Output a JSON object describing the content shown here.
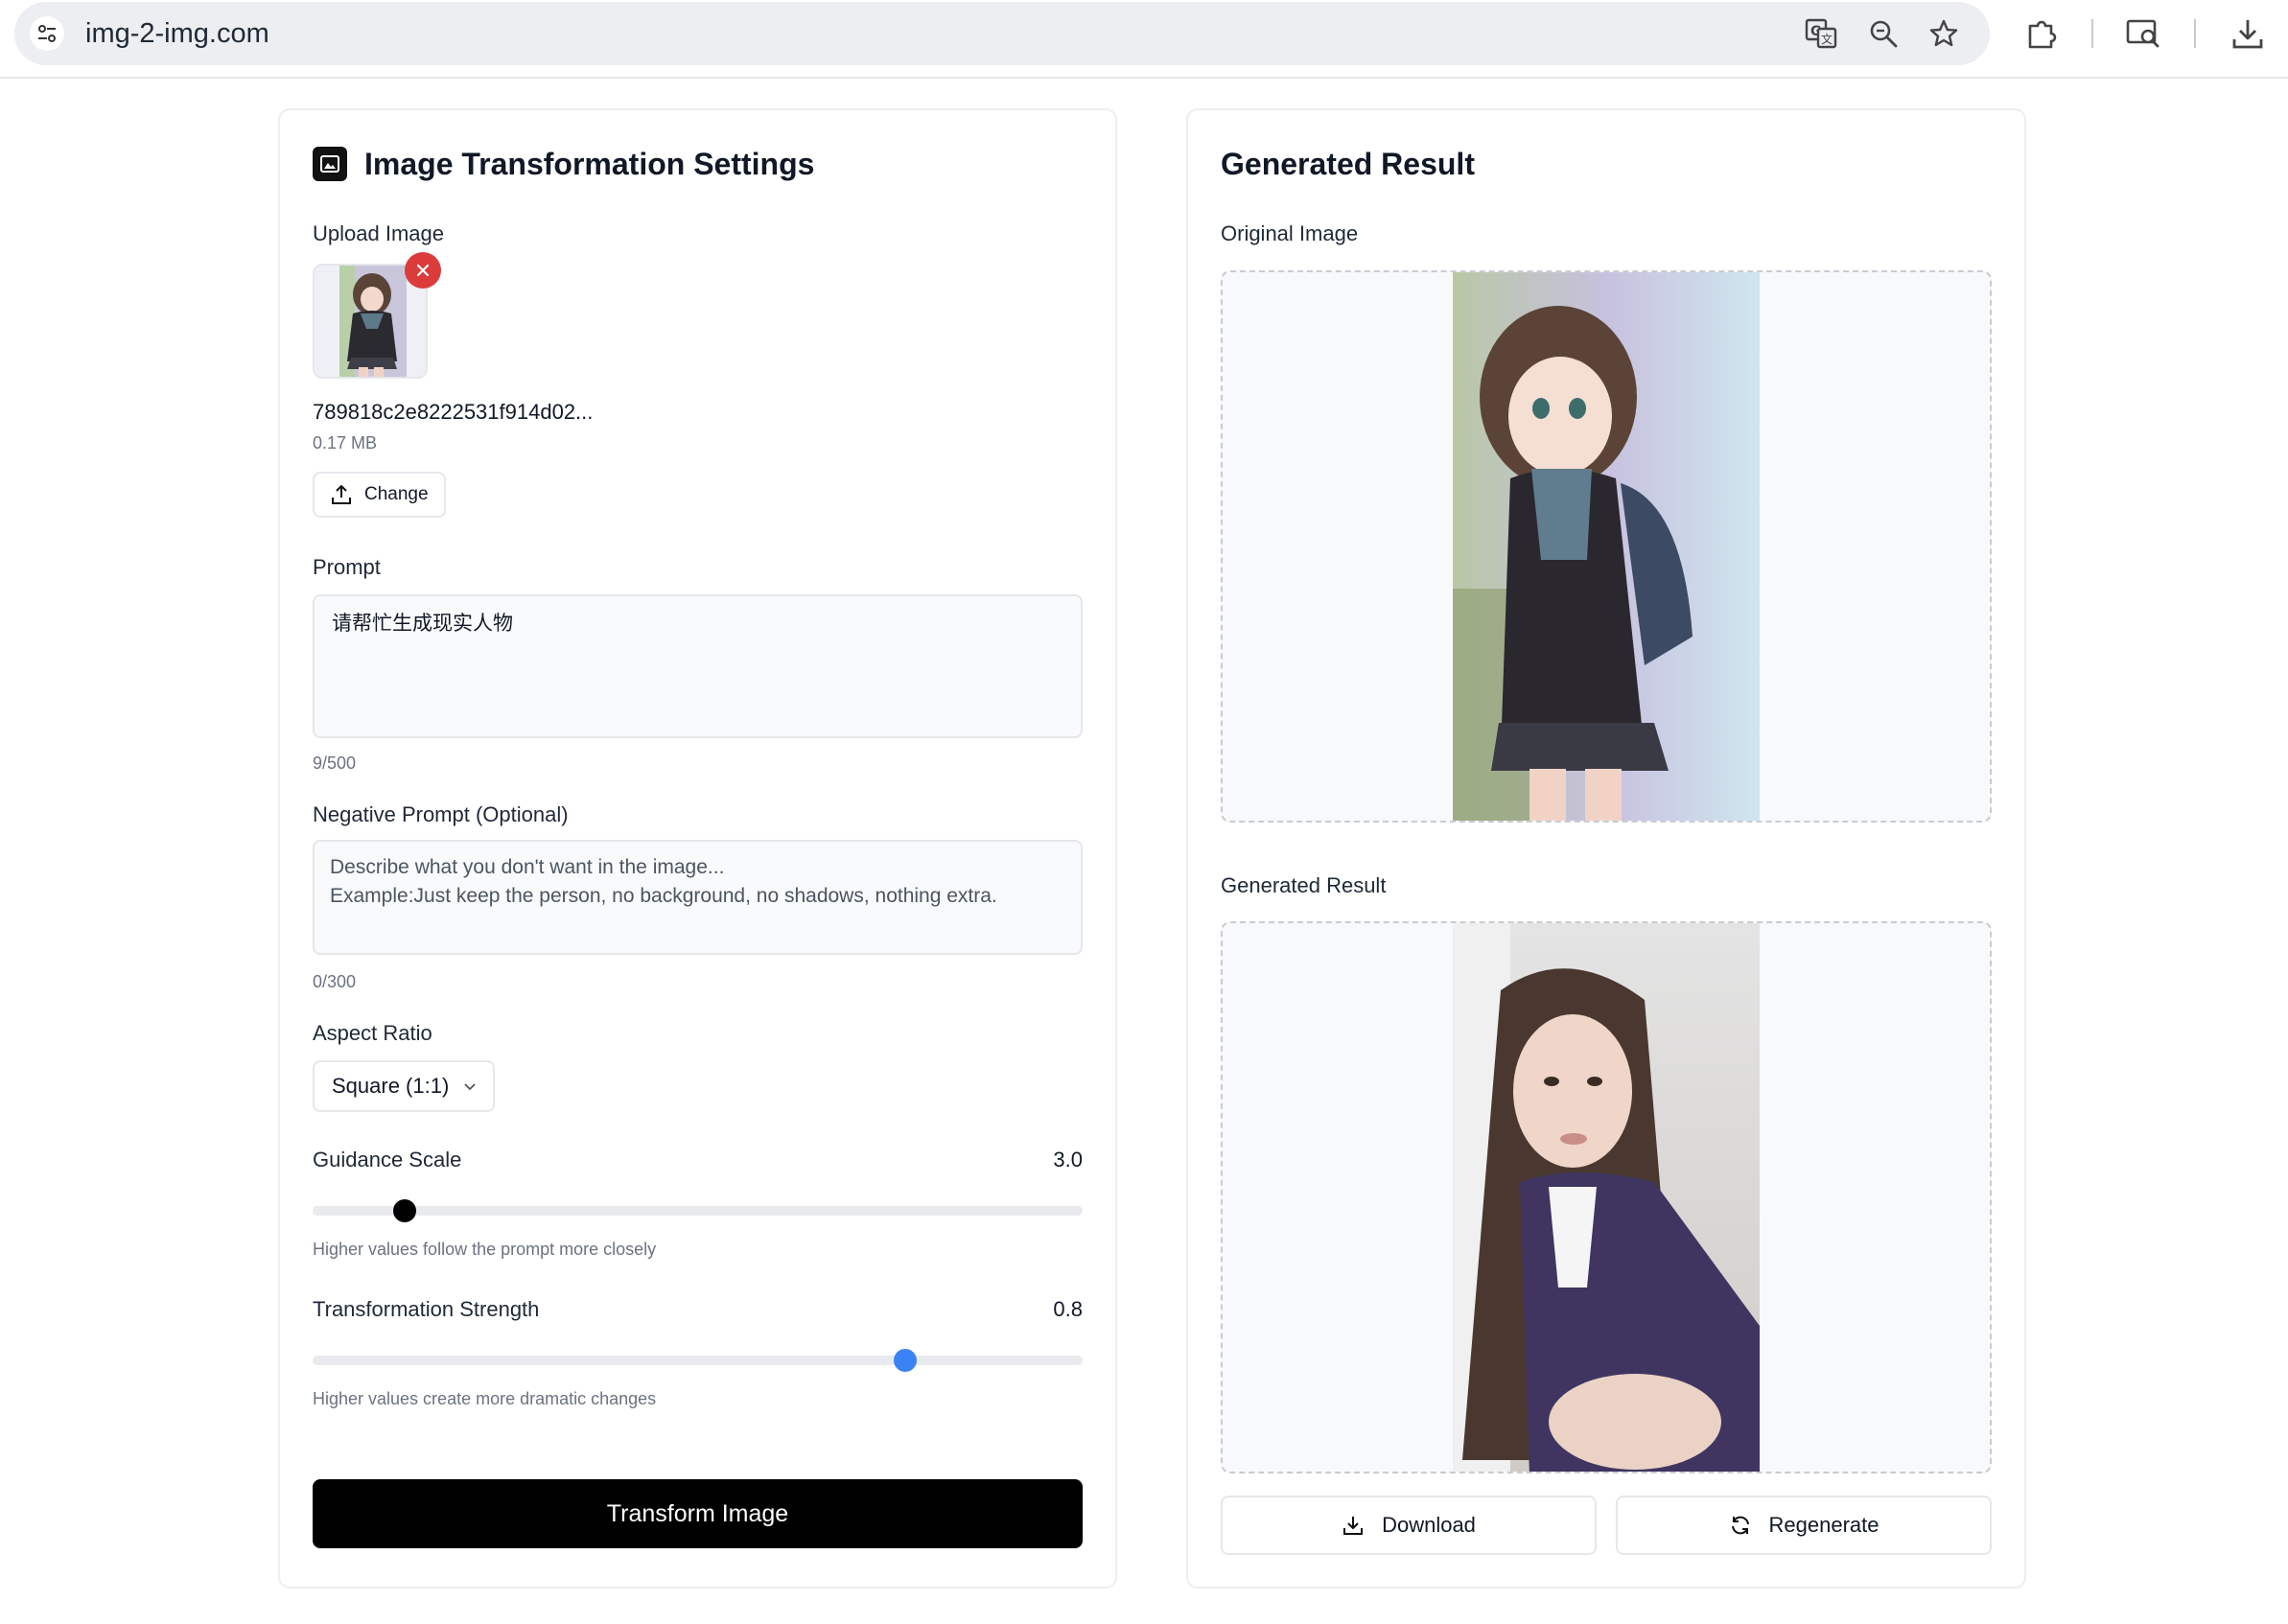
{
  "browser": {
    "url": "img-2-img.com",
    "icons": [
      "site-info-icon",
      "translate-icon",
      "zoom-icon",
      "bookmark-star-icon",
      "extensions-icon",
      "search-lens-icon",
      "download-icon"
    ]
  },
  "settings": {
    "title": "Image Transformation Settings",
    "upload": {
      "label": "Upload Image",
      "filename": "789818c2e8222531f914d02...",
      "filesize": "0.17 MB",
      "change_label": "Change"
    },
    "prompt": {
      "label": "Prompt",
      "value": "请帮忙生成现实人物",
      "counter": "9/500"
    },
    "negative_prompt": {
      "label": "Negative Prompt (Optional)",
      "placeholder_line1": "Describe what you don't want in the image...",
      "placeholder_line2": "Example:Just keep the person, no background, no shadows, nothing extra.",
      "counter": "0/300"
    },
    "aspect_ratio": {
      "label": "Aspect Ratio",
      "selected": "Square (1:1)"
    },
    "guidance_scale": {
      "label": "Guidance Scale",
      "value_text": "3.0",
      "hint": "Higher values follow the prompt more closely",
      "level": 0.12
    },
    "transformation_strength": {
      "label": "Transformation Strength",
      "value_text": "0.8",
      "hint": "Higher values create more dramatic changes",
      "level": 0.77
    },
    "transform_button": "Transform Image"
  },
  "result": {
    "title": "Generated Result",
    "original_label": "Original Image",
    "generated_label": "Generated Result",
    "download_label": "Download",
    "regenerate_label": "Regenerate"
  },
  "colors": {
    "primary": "#000000",
    "slider_active": "#3b82f6",
    "remove_red": "#dc3b3b"
  }
}
